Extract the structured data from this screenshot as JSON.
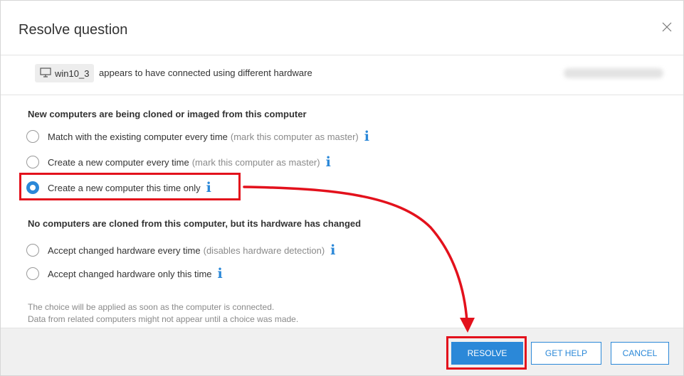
{
  "dialog": {
    "title": "Resolve question",
    "close_icon": "close-icon"
  },
  "hardware": {
    "computer_name": "win10_3",
    "computer_icon": "monitor-icon",
    "message": "appears to have connected using different hardware"
  },
  "section_cloned": {
    "heading": "New computers are being cloned or imaged from this computer",
    "options": [
      {
        "label": "Match with the existing computer every time",
        "hint": "(mark this computer as master)",
        "checked": false
      },
      {
        "label": "Create a new computer every time",
        "hint": "(mark this computer as master)",
        "checked": false
      },
      {
        "label": "Create a new computer this time only",
        "hint": "",
        "checked": true
      }
    ]
  },
  "section_changed": {
    "heading": "No computers are cloned from this computer, but its hardware has changed",
    "options": [
      {
        "label": "Accept changed hardware every time",
        "hint": "(disables hardware detection)",
        "checked": false
      },
      {
        "label": "Accept changed hardware only this time",
        "hint": "",
        "checked": false
      }
    ]
  },
  "note": {
    "line1": "The choice will be applied as soon as the computer is connected.",
    "line2": "Data from related computers might not appear until a choice was made."
  },
  "footer": {
    "resolve_label": "RESOLVE",
    "help_label": "GET HELP",
    "cancel_label": "CANCEL"
  },
  "colors": {
    "accent": "#2b88d8",
    "annotation": "#e3111c"
  },
  "info_glyph": "i"
}
